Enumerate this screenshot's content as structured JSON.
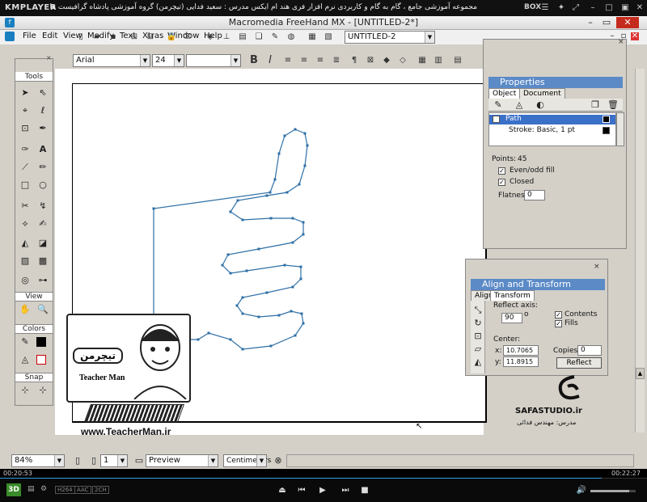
{
  "player": {
    "logo": "KMPLAYER",
    "title": "مجموعه آموزشی جامع ، گام به گام و کاربردی نرم افزار فری هند ام ایکس  مدرس : سعید فدایی (تیچرمن) گروه آموزشی پادشاه گرافیست ها",
    "box_label": "BOX",
    "time_elapsed": "00:20:53",
    "time_total": "00:22:27",
    "progress": 0.93,
    "badge": "3D",
    "codec_badges": [
      "H264",
      "AAC",
      "2CH"
    ]
  },
  "app": {
    "title": "Macromedia FreeHand MX - [UNTITLED-2*]"
  },
  "menu": [
    "File",
    "Edit",
    "View",
    "Modify",
    "Text",
    "Xtras",
    "Window",
    "Help"
  ],
  "toolbar": {
    "doc_name": "UNTITLED-2",
    "font": "Arial",
    "size": "24"
  },
  "tools": {
    "title": "Tools",
    "view_label": "View",
    "colors_label": "Colors",
    "snap_label": "Snap"
  },
  "properties": {
    "title": "Properties",
    "tabs": [
      "Object",
      "Document"
    ],
    "items": [
      "Path",
      "Stroke: Basic, 1 pt"
    ],
    "points_label": "Points:",
    "points": "45",
    "evenodd_label": "Even/odd fill",
    "closed_label": "Closed",
    "flatness_label": "Flatness:",
    "flatness": "0"
  },
  "align": {
    "title": "Align and Transform",
    "tabs": [
      "Align",
      "Transform"
    ],
    "reflect_label": "Reflect axis:",
    "reflect_value": "90",
    "reflect_unit": "o",
    "contents_label": "Contents",
    "fills_label": "Fills",
    "center_label": "Center:",
    "x_label": "x:",
    "x": "10.7065",
    "y_label": "y:",
    "y": "11.8915",
    "copies_label": "Copies:",
    "copies": "0",
    "reflect_button": "Reflect"
  },
  "status": {
    "zoom": "84%",
    "page": "1",
    "view_mode": "Preview",
    "units": "Centimeters"
  },
  "watermark": {
    "brand": "SAFASTUDIO.ir",
    "teacher": "مدرس: مهندس فدائی",
    "site": "www.TeacherMan.ir",
    "logo_title": "تیچرمن",
    "logo_sub": "Teacher Man"
  }
}
